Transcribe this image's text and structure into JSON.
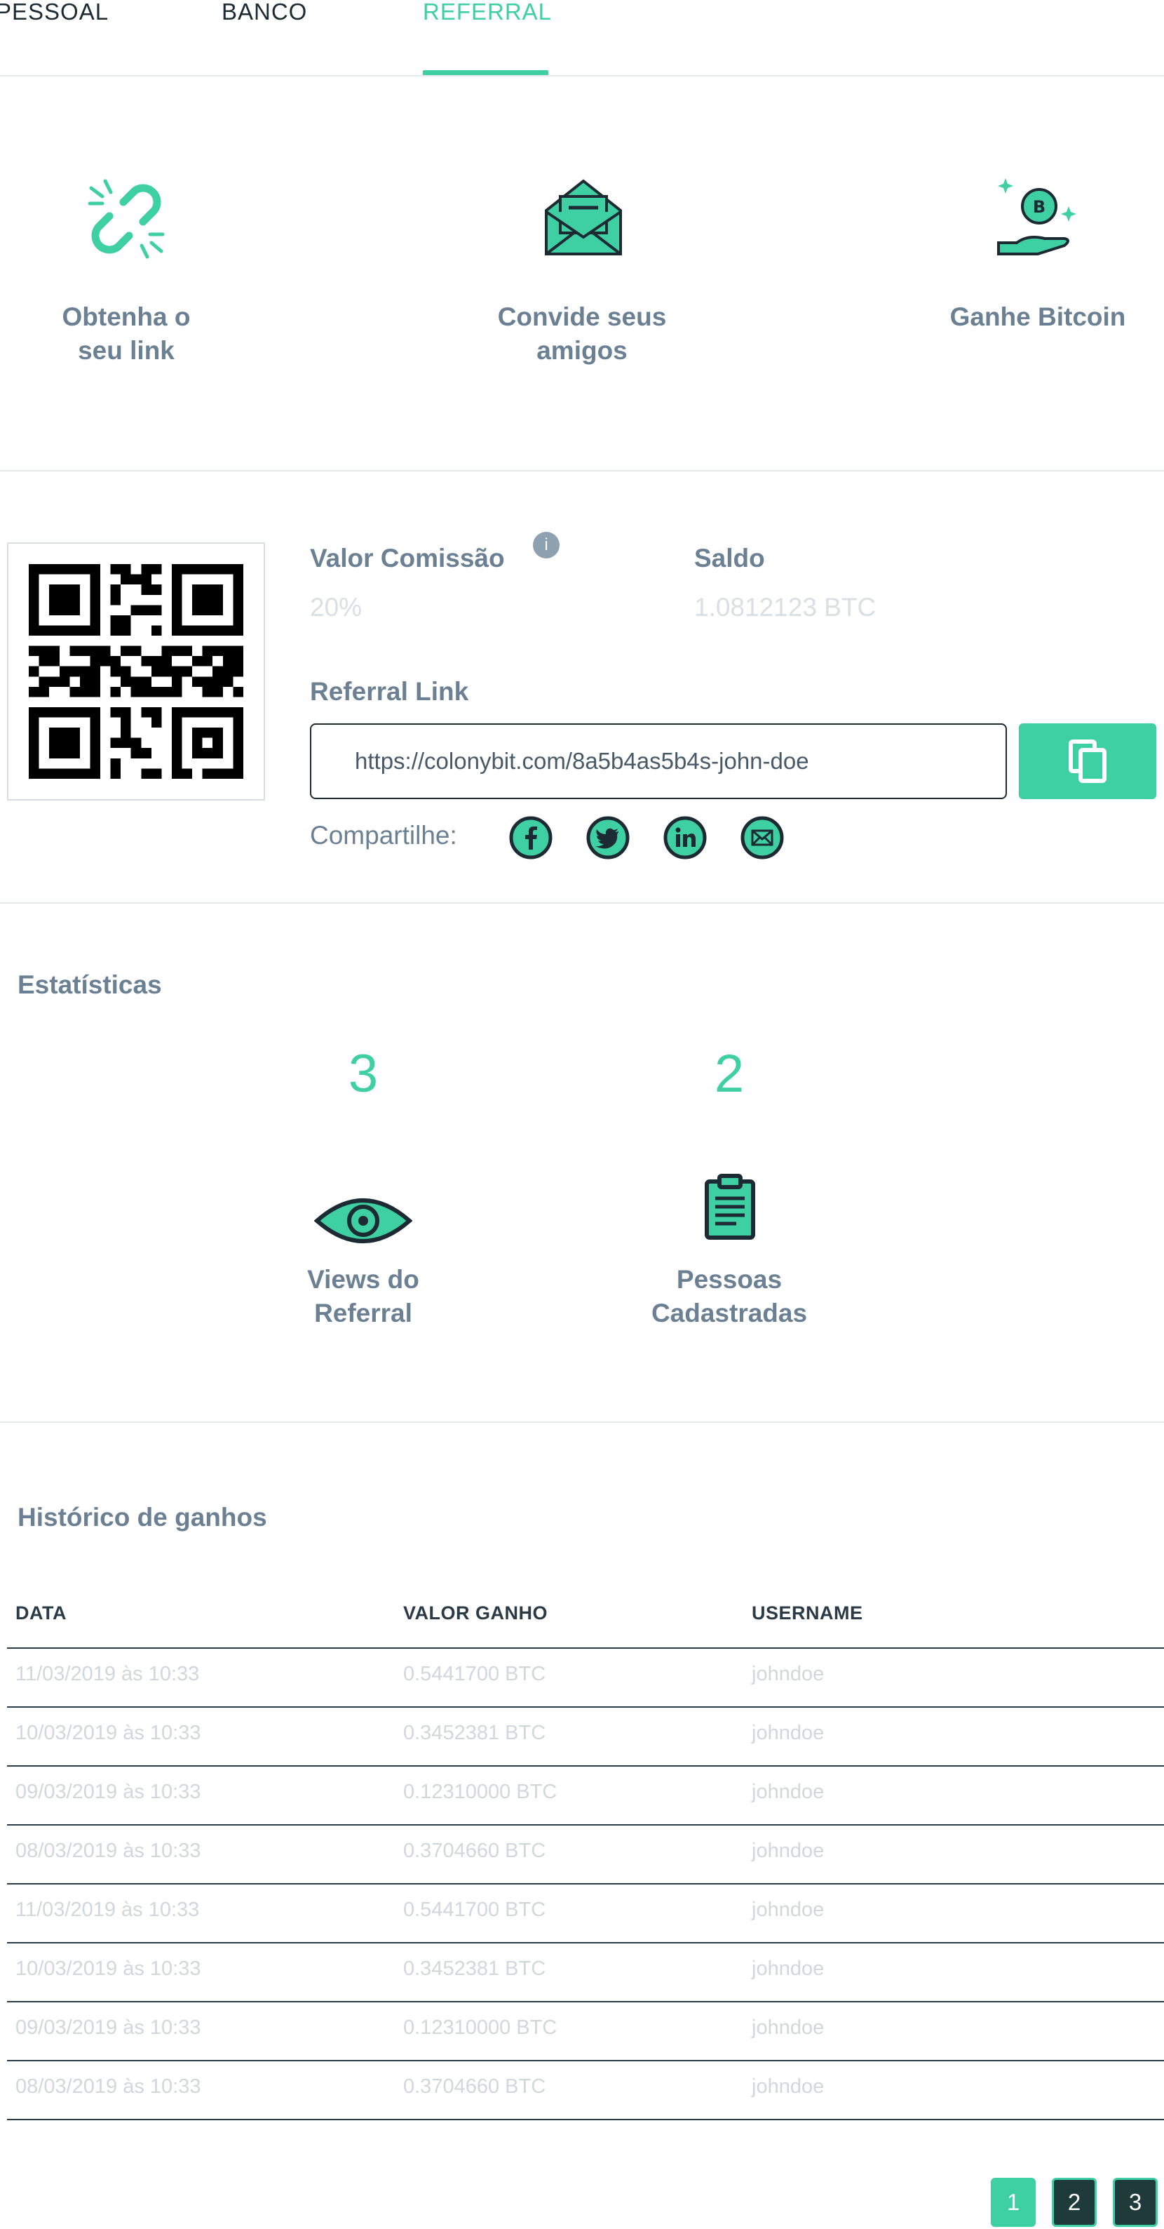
{
  "tabs": [
    {
      "label": "PESSOAL"
    },
    {
      "label": "BANCO"
    },
    {
      "label": "REFERRAL"
    }
  ],
  "active_tab": "REFERRAL",
  "steps": [
    {
      "icon": "broken-link-icon",
      "label_line1": "Obtenha o",
      "label_line2": "seu link"
    },
    {
      "icon": "envelope-icon",
      "label_line1": "Convide seus",
      "label_line2": "amigos"
    },
    {
      "icon": "hand-bitcoin-icon",
      "label_line1": "Ganhe Bitcoin",
      "label_line2": ""
    }
  ],
  "referral": {
    "qr_icon": "qr-code-icon",
    "commission_label": "Valor Comissão",
    "commission_info": "i",
    "commission_value": "20%",
    "balance_label": "Saldo",
    "balance_value": "1.0812123 BTC",
    "link_label": "Referral Link",
    "link_value": "https://colonybit.com/8a5b4as5b4s-john-doe",
    "copy_icon": "copy-icon",
    "share_label": "Compartilhe:",
    "share_icons": [
      "facebook-icon",
      "twitter-icon",
      "linkedin-icon",
      "email-icon"
    ]
  },
  "stats": {
    "title": "Estatísticas",
    "views": {
      "value": "3",
      "label_line1": "Views do",
      "label_line2": "Referral",
      "icon": "eye-icon"
    },
    "signups": {
      "value": "2",
      "label_line1": "Pessoas",
      "label_line2": "Cadastradas",
      "icon": "clipboard-icon"
    }
  },
  "history": {
    "title": "Histórico de ganhos",
    "columns": [
      "DATA",
      "VALOR GANHO",
      "USERNAME"
    ],
    "rows": [
      [
        "11/03/2019 às 10:33",
        "0.5441700 BTC",
        "johndoe"
      ],
      [
        "10/03/2019 às 10:33",
        "0.3452381 BTC",
        "johndoe"
      ],
      [
        "09/03/2019 às 10:33",
        "0.12310000 BTC",
        "johndoe"
      ],
      [
        "08/03/2019 às 10:33",
        "0.3704660 BTC",
        "johndoe"
      ],
      [
        "11/03/2019 às 10:33",
        "0.5441700 BTC",
        "johndoe"
      ],
      [
        "10/03/2019 às 10:33",
        "0.3452381 BTC",
        "johndoe"
      ],
      [
        "09/03/2019 às 10:33",
        "0.12310000 BTC",
        "johndoe"
      ],
      [
        "08/03/2019 às 10:33",
        "0.3704660 BTC",
        "johndoe"
      ]
    ]
  },
  "pagination": {
    "pages": [
      "1",
      "2",
      "3"
    ],
    "current": "1"
  },
  "colors": {
    "accent": "#3ecfa3",
    "text_muted": "#6b8193",
    "text_dark": "#1c2b33",
    "value_light": "#d0d7dd"
  }
}
